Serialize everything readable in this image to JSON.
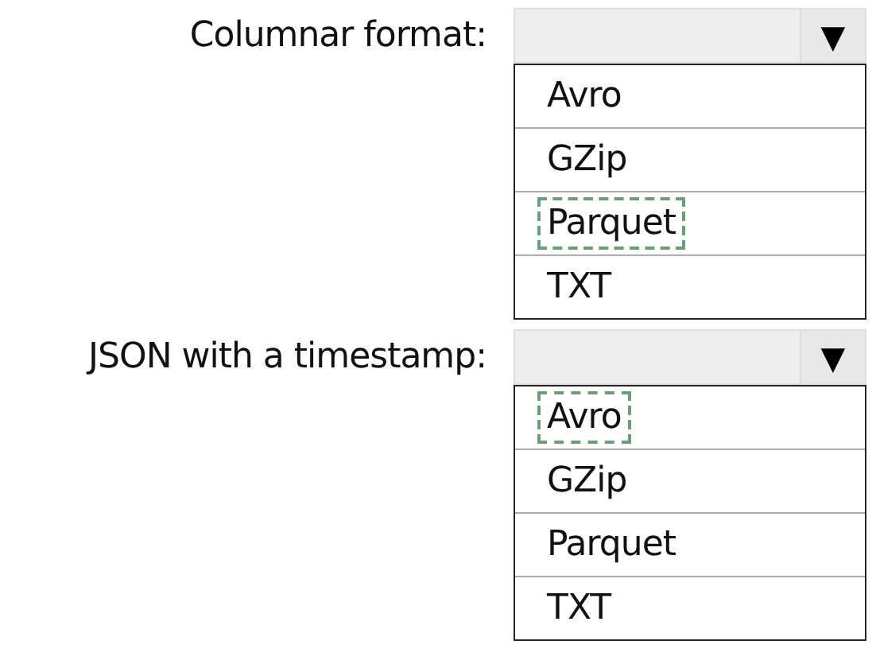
{
  "questions": [
    {
      "label": "Columnar format:",
      "arrow": "▼",
      "options": [
        {
          "label": "Avro",
          "selected": false
        },
        {
          "label": "GZip",
          "selected": false
        },
        {
          "label": "Parquet",
          "selected": true
        },
        {
          "label": "TXT",
          "selected": false
        }
      ]
    },
    {
      "label": "JSON with a timestamp:",
      "arrow": "▼",
      "options": [
        {
          "label": "Avro",
          "selected": true
        },
        {
          "label": "GZip",
          "selected": false
        },
        {
          "label": "Parquet",
          "selected": false
        },
        {
          "label": "TXT",
          "selected": false
        }
      ]
    }
  ]
}
